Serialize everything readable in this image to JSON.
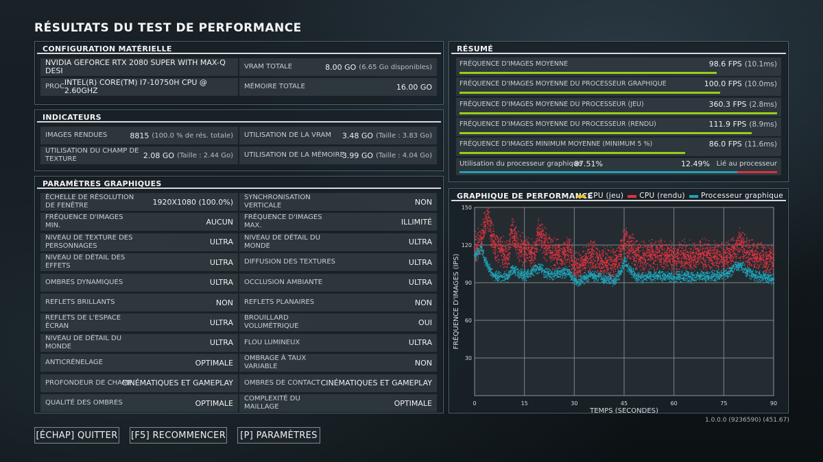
{
  "title": "RÉSULTATS DU TEST DE PERFORMANCE",
  "hardware": {
    "header": "CONFIGURATION MATÉRIELLE",
    "gpu": "NVIDIA GEFORCE RTX 2080 SUPER WITH MAX-Q DESI",
    "cpu_prefix": "PROC",
    "cpu": "INTEL(R) CORE(TM) I7-10750H CPU @ 2.60GHZ",
    "vram_label": "VRAM TOTALE",
    "vram_value": "8.00 GO",
    "vram_sub": "(6.65 Go disponibles)",
    "mem_label": "MÉMOIRE TOTALE",
    "mem_value": "16.00 GO"
  },
  "indicators": {
    "header": "INDICATEURS",
    "frames_label": "IMAGES RENDUES",
    "frames_value": "8815",
    "frames_sub": "(100.0 % de rés. totale)",
    "vram_use_label": "UTILISATION DE LA VRAM",
    "vram_use_value": "3.48 GO",
    "vram_use_sub": "(Taille : 3.83 Go)",
    "tex_label": "UTILISATION DU CHAMP DE TEXTURE",
    "tex_value": "2.08 GO",
    "tex_sub": "(Taille : 2.44 Go)",
    "mem_use_label": "UTILISATION DE LA MÉMOIRE",
    "mem_use_value": "3.99 GO",
    "mem_use_sub": "(Taille : 4.04 Go)"
  },
  "graphics": {
    "header": "PARAMÈTRES GRAPHIQUES",
    "rows": [
      [
        {
          "label": "ÉCHELLE DE RÉSOLUTION DE FENÊTRE",
          "value": "1920X1080 (100.0%)"
        },
        {
          "label": "SYNCHRONISATION VERTICALE",
          "value": "NON"
        }
      ],
      [
        {
          "label": "FRÉQUENCE D'IMAGES MIN.",
          "value": "AUCUN"
        },
        {
          "label": "FRÉQUENCE D'IMAGES MAX.",
          "value": "ILLIMITÉ"
        }
      ],
      [
        {
          "label": "NIVEAU DE TEXTURE DES PERSONNAGES",
          "value": "ULTRA"
        },
        {
          "label": "NIVEAU DE DÉTAIL DU MONDE",
          "value": "ULTRA"
        }
      ],
      [
        {
          "label": "NIVEAU DE DÉTAIL DES EFFETS",
          "value": "ULTRA"
        },
        {
          "label": "DIFFUSION DES TEXTURES",
          "value": "ULTRA"
        }
      ],
      [
        {
          "label": "OMBRES DYNAMIQUES",
          "value": "ULTRA"
        },
        {
          "label": "OCCLUSION AMBIANTE",
          "value": "ULTRA"
        }
      ],
      [
        {
          "label": "REFLETS BRILLANTS",
          "value": "NON"
        },
        {
          "label": "REFLETS PLANAIRES",
          "value": "NON"
        }
      ],
      [
        {
          "label": "REFLETS DE L'ESPACE ÉCRAN",
          "value": "ULTRA"
        },
        {
          "label": "BROUILLARD VOLUMÉTRIQUE",
          "value": "OUI"
        }
      ],
      [
        {
          "label": "NIVEAU DE DÉTAIL DU MONDE",
          "value": "ULTRA"
        },
        {
          "label": "FLOU LUMINEUX",
          "value": "ULTRA"
        }
      ],
      [
        {
          "label": "ANTICRÉNELAGE",
          "value": "OPTIMALE"
        },
        {
          "label": "OMBRAGE À TAUX VARIABLE",
          "value": "NON"
        }
      ],
      [
        {
          "label": "PROFONDEUR DE CHAMP",
          "value": "CINÉMATIQUES ET GAMEPLAY"
        },
        {
          "label": "OMBRES DE CONTACT",
          "value": "CINÉMATIQUES ET GAMEPLAY"
        }
      ],
      [
        {
          "label": "QUALITÉ DES OMBRES",
          "value": "OPTIMALE"
        },
        {
          "label": "COMPLEXITÉ DU MAILLAGE",
          "value": "OPTIMALE"
        }
      ]
    ]
  },
  "summary": {
    "header": "RÉSUMÉ",
    "rows": [
      {
        "label": "FRÉQUENCE D'IMAGES MOYENNE",
        "fps": "98.6 FPS",
        "ms": "(10.1ms)",
        "fraction": 0.81
      },
      {
        "label": "FRÉQUENCE D'IMAGES MOYENNE DU PROCESSEUR GRAPHIQUE",
        "fps": "100.0 FPS",
        "ms": "(10.0ms)",
        "fraction": 0.82
      },
      {
        "label": "FRÉQUENCE D'IMAGES MOYENNE DU PROCESSEUR (JEU)",
        "fps": "360.3 FPS",
        "ms": "(2.8ms)",
        "fraction": 1.0
      },
      {
        "label": "FRÉQUENCE D'IMAGES MOYENNE DU PROCESSEUR (RENDU)",
        "fps": "111.9 FPS",
        "ms": "(8.9ms)",
        "fraction": 0.92
      },
      {
        "label": "FRÉQUENCE D'IMAGES MINIMUM MOYENNE (MINIMUM 5 %)",
        "fps": "86.0 FPS",
        "ms": "(11.6ms)",
        "fraction": 0.71
      }
    ],
    "gpu_label": "Utilisation du processeur graphique",
    "gpu_pct": "87.51%",
    "cpu_pct": "12.49%",
    "cpu_label": "Lié au processeur",
    "gpu_fraction": 0.8751,
    "gpu_color": "#1fa3b8",
    "cpu_color": "#d93440"
  },
  "chart_data": {
    "type": "scatter",
    "title": "GRAPHIQUE DE PERFORMANCE",
    "xlabel": "TEMPS (SECONDES)",
    "ylabel": "FRÉQUENCE D'IMAGES (IPS)",
    "xlim": [
      0,
      90
    ],
    "ylim": [
      0,
      150
    ],
    "xticks": [
      "0",
      "15",
      "30",
      "45",
      "60",
      "75",
      "90"
    ],
    "yticks": [
      "30",
      "60",
      "90",
      "120",
      "150"
    ],
    "grid": true,
    "legend_position": "top",
    "series": [
      {
        "name": "CPU (jeu)",
        "color": "#e8c21a",
        "note_values_above_axis": true,
        "values": []
      },
      {
        "name": "CPU (rendu)",
        "color": "#e0323f",
        "x": [
          0,
          2,
          3,
          4,
          5,
          6,
          8,
          10,
          11,
          12,
          14,
          15,
          17,
          18,
          19,
          21,
          23,
          25,
          27,
          28,
          30,
          31,
          33,
          35,
          37,
          39,
          42,
          44,
          45,
          46,
          48,
          50,
          53,
          55,
          58,
          60,
          63,
          65,
          68,
          70,
          72,
          75,
          77,
          78,
          80,
          82,
          84,
          86,
          88,
          90
        ],
        "y": [
          118,
          126,
          138,
          145,
          128,
          120,
          116,
          112,
          132,
          124,
          118,
          115,
          114,
          113,
          130,
          122,
          114,
          112,
          113,
          118,
          104,
          102,
          108,
          112,
          110,
          106,
          105,
          115,
          125,
          120,
          114,
          110,
          112,
          114,
          112,
          110,
          112,
          111,
          113,
          112,
          111,
          110,
          112,
          118,
          121,
          114,
          112,
          110,
          109,
          108
        ]
      },
      {
        "name": "Processeur graphique",
        "color": "#1fa3b8",
        "x": [
          0,
          2,
          3,
          4,
          5,
          6,
          8,
          10,
          11,
          12,
          14,
          15,
          17,
          18,
          19,
          21,
          23,
          25,
          27,
          28,
          30,
          31,
          33,
          35,
          37,
          39,
          42,
          44,
          45,
          46,
          48,
          50,
          53,
          55,
          58,
          60,
          63,
          65,
          68,
          70,
          72,
          75,
          77,
          78,
          80,
          82,
          84,
          86,
          88,
          90
        ],
        "y": [
          112,
          118,
          108,
          104,
          98,
          96,
          95,
          94,
          102,
          100,
          97,
          96,
          98,
          100,
          102,
          99,
          97,
          98,
          98,
          100,
          92,
          91,
          94,
          96,
          95,
          93,
          92,
          99,
          108,
          103,
          97,
          94,
          95,
          96,
          95,
          94,
          96,
          95,
          96,
          95,
          96,
          97,
          99,
          103,
          104,
          99,
          96,
          95,
          94,
          93
        ]
      }
    ]
  },
  "buttons": {
    "quit": "[ÉCHAP] QUITTER",
    "restart": "[F5] RECOMMENCER",
    "settings": "[P] PARAMÈTRES"
  },
  "version": "1.0.0.0 (9236590) (451.67)"
}
